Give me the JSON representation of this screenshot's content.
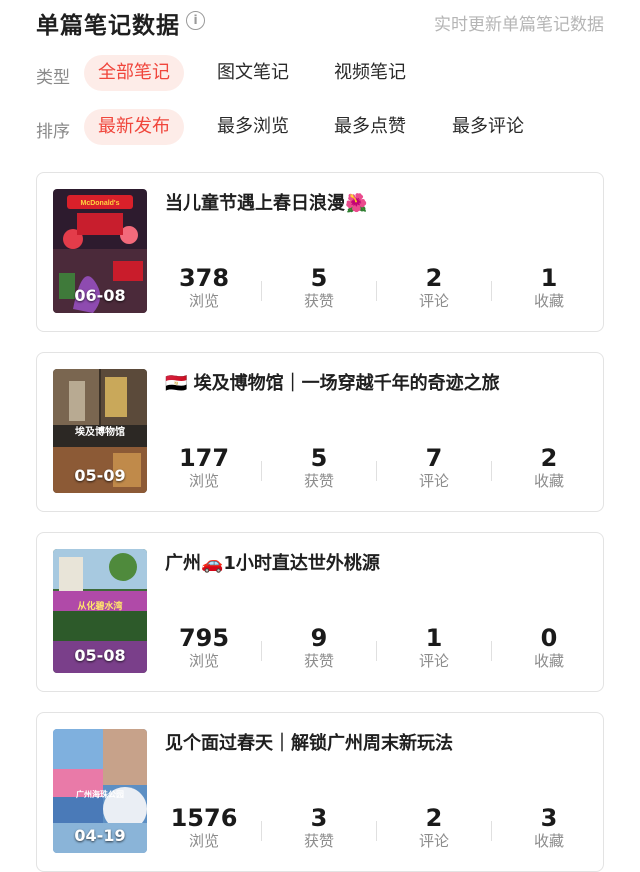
{
  "header": {
    "title": "单篇笔记数据",
    "info_icon": "info-icon",
    "realtime_text": "实时更新单篇笔记数据"
  },
  "filters": {
    "type": {
      "label": "类型",
      "options": [
        "全部笔记",
        "图文笔记",
        "视频笔记"
      ],
      "selected": "全部笔记"
    },
    "sort": {
      "label": "排序",
      "options": [
        "最新发布",
        "最多浏览",
        "最多点赞",
        "最多评论"
      ],
      "selected": "最新发布"
    }
  },
  "colors": {
    "accent": "#f0463c",
    "accent_bg": "#fdece8"
  },
  "notes": [
    {
      "title": "当儿童节遇上春日浪漫🌺",
      "date": "06-08",
      "thumb_text": "McDonald's",
      "stats": [
        {
          "value": "378",
          "label": "浏览"
        },
        {
          "value": "5",
          "label": "获赞"
        },
        {
          "value": "2",
          "label": "评论"
        },
        {
          "value": "1",
          "label": "收藏"
        }
      ]
    },
    {
      "title": "🇪🇬 埃及博物馆｜一场穿越千年的奇迹之旅",
      "date": "05-09",
      "thumb_text": "埃及博物馆",
      "stats": [
        {
          "value": "177",
          "label": "浏览"
        },
        {
          "value": "5",
          "label": "获赞"
        },
        {
          "value": "7",
          "label": "评论"
        },
        {
          "value": "2",
          "label": "收藏"
        }
      ]
    },
    {
      "title": "广州🚗1小时直达世外桃源",
      "date": "05-08",
      "thumb_text": "从化碧水湾",
      "stats": [
        {
          "value": "795",
          "label": "浏览"
        },
        {
          "value": "9",
          "label": "获赞"
        },
        {
          "value": "1",
          "label": "评论"
        },
        {
          "value": "0",
          "label": "收藏"
        }
      ]
    },
    {
      "title": "见个面过春天｜解锁广州周末新玩法",
      "date": "04-19",
      "thumb_text": "广州海珠公园",
      "stats": [
        {
          "value": "1576",
          "label": "浏览"
        },
        {
          "value": "3",
          "label": "获赞"
        },
        {
          "value": "2",
          "label": "评论"
        },
        {
          "value": "3",
          "label": "收藏"
        }
      ]
    }
  ]
}
